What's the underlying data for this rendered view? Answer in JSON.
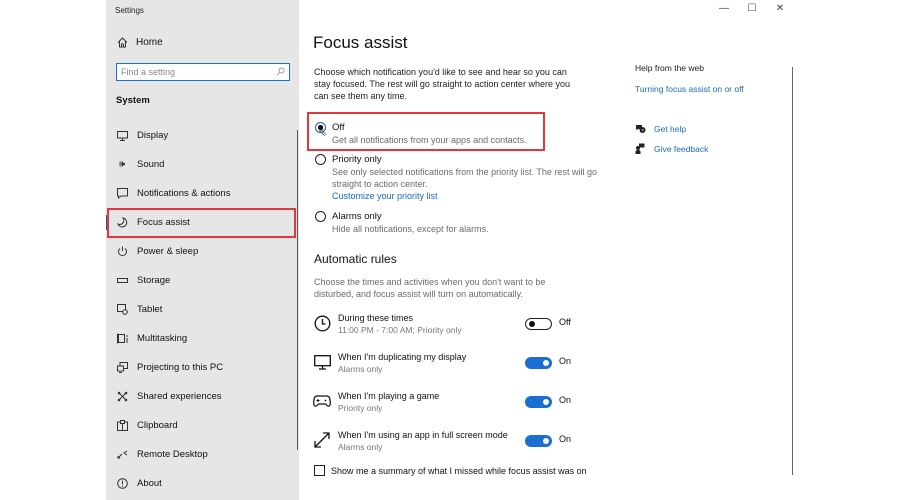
{
  "window": {
    "title": "Settings",
    "controls": {
      "minimize": "—",
      "maximize": "☐",
      "close": "✕"
    }
  },
  "sidebar": {
    "home_label": "Home",
    "search_placeholder": "Find a setting",
    "section_title": "System",
    "items": [
      {
        "label": "Display",
        "icon": "monitor-icon"
      },
      {
        "label": "Sound",
        "icon": "speaker-icon"
      },
      {
        "label": "Notifications & actions",
        "icon": "notification-icon"
      },
      {
        "label": "Focus assist",
        "icon": "moon-icon",
        "selected": true
      },
      {
        "label": "Power & sleep",
        "icon": "power-icon"
      },
      {
        "label": "Storage",
        "icon": "storage-icon"
      },
      {
        "label": "Tablet",
        "icon": "tablet-icon"
      },
      {
        "label": "Multitasking",
        "icon": "multitasking-icon"
      },
      {
        "label": "Projecting to this PC",
        "icon": "projecting-icon"
      },
      {
        "label": "Shared experiences",
        "icon": "shared-icon"
      },
      {
        "label": "Clipboard",
        "icon": "clipboard-icon"
      },
      {
        "label": "Remote Desktop",
        "icon": "remote-desktop-icon"
      },
      {
        "label": "About",
        "icon": "info-icon"
      }
    ]
  },
  "main": {
    "title": "Focus assist",
    "intro": "Choose which notification you'd like to see and hear so you can stay focused. The rest will go straight to action center where you can see them any time.",
    "options": [
      {
        "label": "Off",
        "desc": "Get all notifications from your apps and contacts.",
        "checked": true
      },
      {
        "label": "Priority only",
        "desc": "See only selected notifications from the priority list. The rest will go straight to action center.",
        "link": "Customize your priority list",
        "checked": false
      },
      {
        "label": "Alarms only",
        "desc": "Hide all notifications, except for alarms.",
        "checked": false
      }
    ],
    "automatic_rules": {
      "title": "Automatic rules",
      "desc": "Choose the times and activities when you don't want to be disturbed, and focus assist will turn on automatically.",
      "rules": [
        {
          "title": "During these times",
          "sub": "11:00 PM - 7:00 AM; Priority only",
          "state": "Off",
          "on": false,
          "icon": "clock-icon"
        },
        {
          "title": "When I'm duplicating my display",
          "sub": "Alarms only",
          "state": "On",
          "on": true,
          "icon": "display-icon"
        },
        {
          "title": "When I'm playing a game",
          "sub": "Priority only",
          "state": "On",
          "on": true,
          "icon": "gamepad-icon"
        },
        {
          "title": "When I'm using an app in full screen mode",
          "sub": "Alarms only",
          "state": "On",
          "on": true,
          "icon": "fullscreen-icon"
        }
      ],
      "summary_checkbox": {
        "label": "Show me a summary of what I missed while focus assist was on",
        "checked": false
      }
    }
  },
  "help": {
    "title": "Help from the web",
    "link": "Turning focus assist on or off",
    "get_help": "Get help",
    "give_feedback": "Give feedback"
  },
  "colors": {
    "accent": "#1a6fd1",
    "link": "#1a6bbf",
    "highlight_box": "#e0383e",
    "sidebar_bg": "#e6e6e6"
  }
}
